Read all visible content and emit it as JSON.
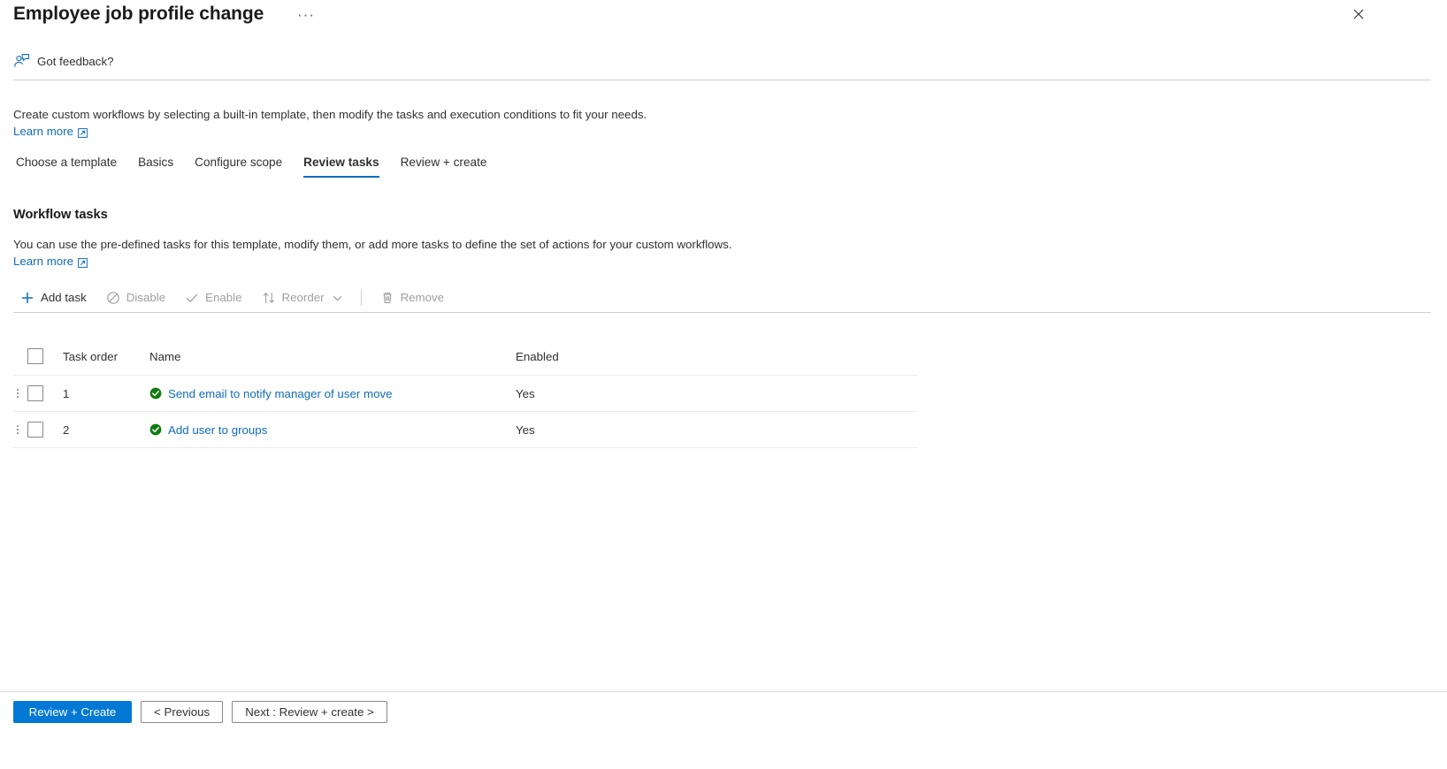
{
  "window": {
    "title": "Employee job profile change",
    "more_options": "···",
    "close_label": "✕"
  },
  "feedback": {
    "label": "Got feedback?",
    "icon": "person-feedback-icon"
  },
  "intro": {
    "text": "Create custom workflows by selecting a built-in template, then modify the tasks and execution conditions to fit your needs.",
    "learn_more": "Learn more"
  },
  "tabs": [
    {
      "label": "Choose a template",
      "active": false
    },
    {
      "label": "Basics",
      "active": false
    },
    {
      "label": "Configure scope",
      "active": false
    },
    {
      "label": "Review tasks",
      "active": true
    },
    {
      "label": "Review + create",
      "active": false
    }
  ],
  "section": {
    "title": "Workflow tasks",
    "description": "You can use the pre-defined tasks for this template, modify them, or add more tasks to define the set of actions for your custom workflows.",
    "learn_more": "Learn more"
  },
  "toolbar": {
    "add_task": "Add task",
    "disable": "Disable",
    "enable": "Enable",
    "reorder": "Reorder",
    "remove": "Remove"
  },
  "table": {
    "columns": {
      "task_order": "Task order",
      "name": "Name",
      "enabled": "Enabled"
    },
    "rows": [
      {
        "order": "1",
        "name": "Send email to notify manager of user move",
        "enabled": "Yes"
      },
      {
        "order": "2",
        "name": "Add user to groups",
        "enabled": "Yes"
      }
    ]
  },
  "footer": {
    "primary": "Review + Create",
    "previous": "< Previous",
    "next": "Next : Review + create >"
  },
  "colors": {
    "accent": "#0078d4",
    "link": "#0f6cbd",
    "success": "#107c10",
    "disabled_text": "#a19f9d"
  }
}
